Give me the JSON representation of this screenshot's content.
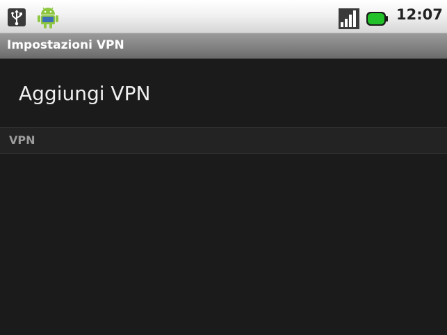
{
  "status_bar": {
    "time": "12:07",
    "icons": {
      "usb": "usb-debugging-icon",
      "android": "android-notification-icon",
      "signal": "signal-strength-icon",
      "battery": "battery-icon"
    },
    "battery_color": "#22c12a"
  },
  "title_bar": {
    "title": "Impostazioni VPN"
  },
  "preferences": {
    "add_vpn_label": "Aggiungi VPN"
  },
  "category": {
    "label": "VPN"
  },
  "colors": {
    "background": "#1b1b1b",
    "title_bar": "#848484",
    "primary_text": "#f0f0f0",
    "category_text": "#9c9c9c"
  }
}
